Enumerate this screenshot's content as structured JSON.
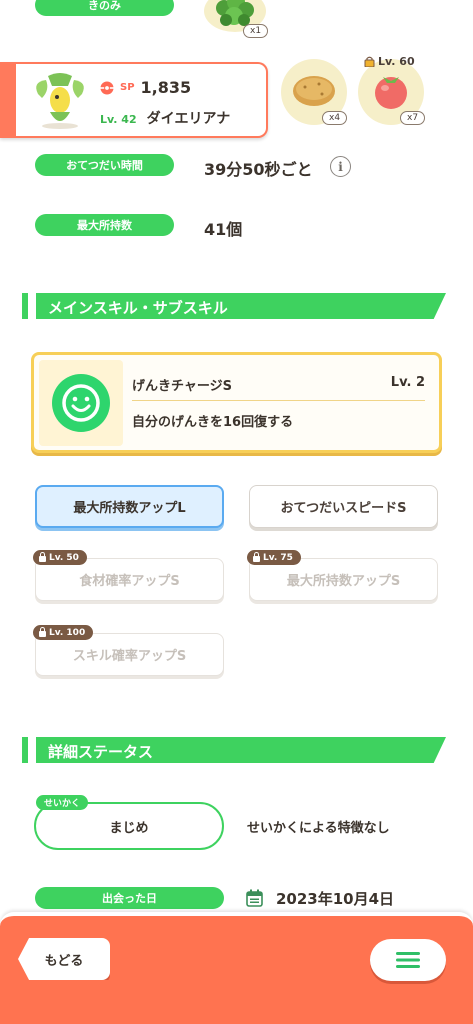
{
  "top_stat": {
    "label": "きのみ"
  },
  "berry": {
    "icon": "berry-icon",
    "count": "x1"
  },
  "mon": {
    "sp_label": "SP",
    "sp_value": "1,835",
    "level": "Lv. 42",
    "name": "ダイエリアナ"
  },
  "ingredients": [
    {
      "icon": "potato-icon",
      "count": "x4"
    },
    {
      "icon": "tomato-icon",
      "count": "x7",
      "lock_level": "Lv. 60"
    }
  ],
  "stats": [
    {
      "label": "おてつだい時間",
      "value": "39分50秒ごと"
    },
    {
      "label": "最大所持数",
      "value": "41個"
    }
  ],
  "skills_section": {
    "title": "メインスキル・サブスキル"
  },
  "main_skill": {
    "name": "げんきチャージS",
    "level": "Lv. 2",
    "description": "自分のげんきを16回復する"
  },
  "sub_skills": [
    {
      "label": "最大所持数アップL",
      "state": "active"
    },
    {
      "label": "おてつだいスピードS",
      "state": "unlocked"
    },
    {
      "label": "食材確率アップS",
      "state": "locked",
      "unlock_level": "Lv. 50"
    },
    {
      "label": "最大所持数アップS",
      "state": "locked",
      "unlock_level": "Lv. 75"
    },
    {
      "label": "スキル確率アップS",
      "state": "locked",
      "unlock_level": "Lv. 100"
    }
  ],
  "details_section": {
    "title": "詳細ステータス"
  },
  "nature": {
    "tag": "せいかく",
    "value": "まじめ",
    "description": "せいかくによる特徴なし"
  },
  "met_date": {
    "label": "出会った日",
    "value": "2023年10月4日"
  },
  "bottom_bar": {
    "back_label": "もどる"
  },
  "colors": {
    "accent_green": "#3ed25f",
    "bottom_bar": "#ff7350",
    "skill_border": "#f7cf58"
  }
}
